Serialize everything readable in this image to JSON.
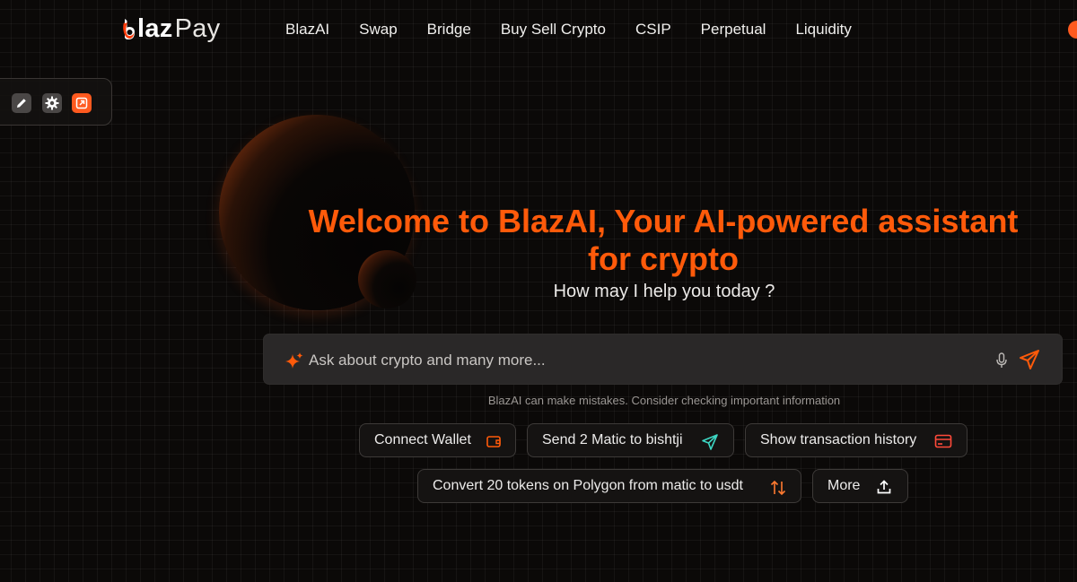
{
  "brand": {
    "logo_b": "b",
    "logo_laz": "laz",
    "logo_pay": "Pay",
    "accent_color": "#ff5a0a"
  },
  "nav": {
    "items": [
      {
        "label": "BlazAI"
      },
      {
        "label": "Swap"
      },
      {
        "label": "Bridge"
      },
      {
        "label": "Buy Sell Crypto"
      },
      {
        "label": "CSIP"
      },
      {
        "label": "Perpetual"
      },
      {
        "label": "Liquidity"
      }
    ]
  },
  "tool_panel": {
    "icons": [
      "pencil-icon",
      "gear-icon",
      "external-link-icon"
    ]
  },
  "hero": {
    "title": "Welcome to BlazAI, Your AI-powered assistant for crypto",
    "subtitle": "How may I help you today ?"
  },
  "prompt": {
    "placeholder": "Ask about crypto and many more...",
    "value": "",
    "icons": [
      "sparkle-icon",
      "microphone-icon",
      "send-icon"
    ]
  },
  "disclaimer": "BlazAI can make mistakes. Consider checking important information",
  "suggestions": [
    {
      "label": "Connect Wallet",
      "icon": "wallet-icon"
    },
    {
      "label": "Send 2 Matic to bishtji",
      "icon": "paper-plane-icon"
    },
    {
      "label": "Show transaction history",
      "icon": "credit-card-icon"
    },
    {
      "label": "Convert 20 tokens on Polygon from matic to usdt",
      "icon": "swap-arrows-icon"
    },
    {
      "label": "More",
      "icon": "upload-icon"
    }
  ]
}
